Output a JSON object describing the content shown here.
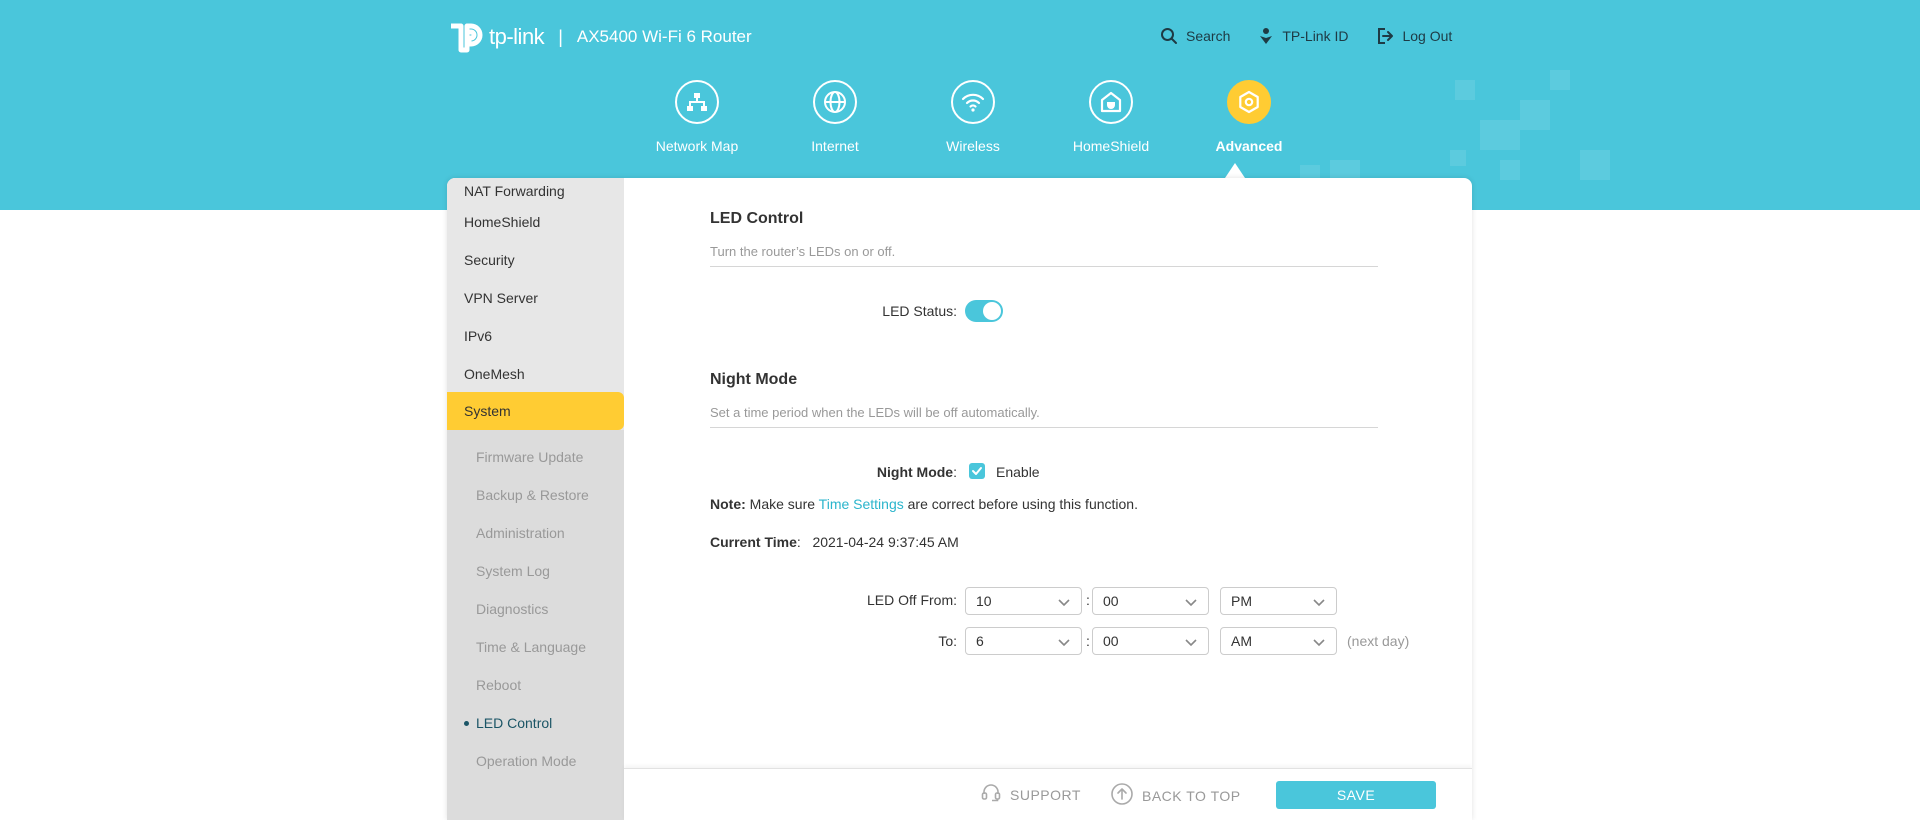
{
  "header": {
    "brand": "tp-link",
    "separator": "|",
    "model": "AX5400 Wi-Fi 6 Router",
    "links": [
      {
        "label": "Search",
        "icon": "search-icon"
      },
      {
        "label": "TP-Link ID",
        "icon": "tplink-id-icon"
      },
      {
        "label": "Log Out",
        "icon": "logout-icon"
      }
    ]
  },
  "nav": {
    "items": [
      {
        "label": "Network Map",
        "icon": "network-map-icon"
      },
      {
        "label": "Internet",
        "icon": "globe-icon"
      },
      {
        "label": "Wireless",
        "icon": "wifi-icon"
      },
      {
        "label": "HomeShield",
        "icon": "homeshield-icon"
      },
      {
        "label": "Advanced",
        "icon": "gear-icon",
        "active": true
      }
    ]
  },
  "sidebar": {
    "items": [
      "NAT Forwarding",
      "HomeShield",
      "Security",
      "VPN Server",
      "IPv6",
      "OneMesh",
      "System"
    ],
    "active": "System",
    "subitems": [
      "Firmware Update",
      "Backup & Restore",
      "Administration",
      "System Log",
      "Diagnostics",
      "Time & Language",
      "Reboot",
      "LED Control",
      "Operation Mode"
    ],
    "current_sub": "LED Control"
  },
  "led_control": {
    "title": "LED Control",
    "description": "Turn the router’s LEDs on or off.",
    "status_label": "LED Status:",
    "status_on": true
  },
  "night_mode": {
    "title": "Night Mode",
    "description": "Set a time period when the LEDs will be off automatically.",
    "label": "Night Mode",
    "colon": ":",
    "checkbox_label": "Enable",
    "enabled": true,
    "note_prefix": "Note:",
    "note_before": " Make sure ",
    "note_link": "Time Settings",
    "note_after": " are correct before using this function.",
    "current_time_label": "Current Time",
    "current_time_value": "2021-04-24 9:37:45 AM",
    "off_from_label": "LED Off From:",
    "to_label": "To:",
    "from": {
      "hour": "10",
      "minute": "00",
      "period": "PM"
    },
    "to": {
      "hour": "6",
      "minute": "00",
      "period": "AM"
    },
    "time_sep": ":",
    "next_day": "(next day)"
  },
  "footer": {
    "support": "SUPPORT",
    "back_to_top": "BACK TO TOP",
    "save": "SAVE"
  },
  "colors": {
    "brand_cyan": "#4ac6db",
    "active_yellow": "#ffcc33"
  }
}
